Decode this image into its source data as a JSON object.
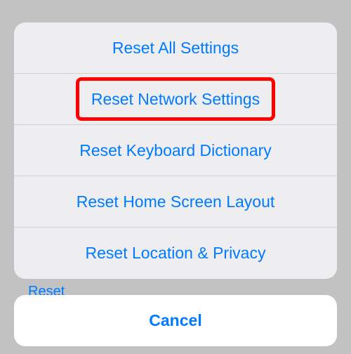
{
  "actions": {
    "reset_all": "Reset All Settings",
    "reset_network": "Reset Network Settings",
    "reset_keyboard": "Reset Keyboard Dictionary",
    "reset_home": "Reset Home Screen Layout",
    "reset_location": "Reset Location & Privacy"
  },
  "cancel_label": "Cancel",
  "background_peek": "Reset",
  "highlighted": "reset_network",
  "colors": {
    "ios_blue": "#007aff",
    "highlight_red": "#ff0000",
    "sheet_bg": "#eeeef0",
    "divider": "#d0d0d3"
  }
}
